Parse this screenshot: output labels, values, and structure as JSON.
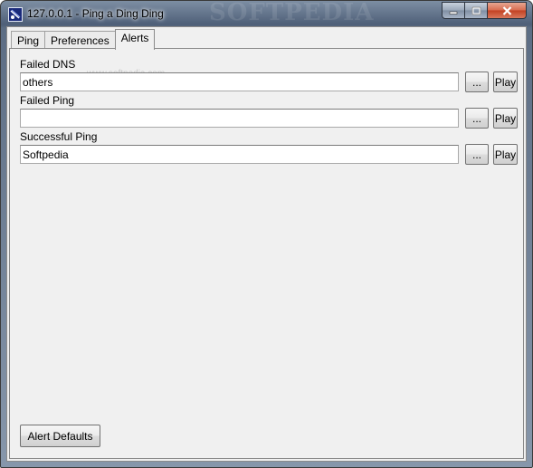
{
  "window": {
    "title": "127.0.0.1 - Ping a Ding Ding",
    "title_watermark": "SOFTPEDIA",
    "icon": "ping-app-icon",
    "caption_icons": [
      "minimize-icon",
      "maximize-icon",
      "close-icon"
    ]
  },
  "tabs": [
    {
      "label": "Ping",
      "active": false
    },
    {
      "label": "Preferences",
      "active": false
    },
    {
      "label": "Alerts",
      "active": true
    }
  ],
  "watermark": "www.softpedia.com",
  "alerts": [
    {
      "label": "Failed DNS",
      "value": "others",
      "browse_label": "...",
      "play_label": "Play"
    },
    {
      "label": "Failed Ping",
      "value": "",
      "browse_label": "...",
      "play_label": "Play"
    },
    {
      "label": "Successful Ping",
      "value": "Softpedia",
      "browse_label": "...",
      "play_label": "Play"
    }
  ],
  "defaults_button": "Alert Defaults",
  "colors": {
    "client_bg": "#f0f0f0",
    "close_button": "#c24122",
    "titlebar": "#4e5f78"
  }
}
